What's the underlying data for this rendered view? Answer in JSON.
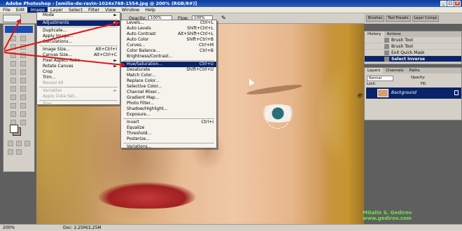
{
  "window": {
    "title": "Adobe Photoshop - [emilie-de-ravin-1024x768-1554.jpg @ 200% (RGB/8#)]"
  },
  "menubar": [
    "File",
    "Edit",
    "Image",
    "Layer",
    "Select",
    "Filter",
    "View",
    "Window",
    "Help"
  ],
  "options": {
    "opacity_label": "Opacity:",
    "opacity_value": "100%",
    "flow_label": "Flow:",
    "flow_value": "100%"
  },
  "wellbar": [
    "Brushes",
    "Tool Presets",
    "Layer Comps"
  ],
  "image_menu": [
    {
      "label": "Mode",
      "shortcut": "►"
    },
    {
      "sep": true
    },
    {
      "label": "Adjustments",
      "shortcut": "►",
      "state": "selected"
    },
    {
      "sep": true
    },
    {
      "label": "Duplicate..."
    },
    {
      "label": "Apply Image..."
    },
    {
      "label": "Calculations..."
    },
    {
      "sep": true
    },
    {
      "label": "Image Size...",
      "shortcut": "Alt+Ctrl+I"
    },
    {
      "label": "Canvas Size...",
      "shortcut": "Alt+Ctrl+C"
    },
    {
      "label": "Pixel Aspect Ratio",
      "shortcut": "►"
    },
    {
      "label": "Rotate Canvas",
      "shortcut": "►"
    },
    {
      "label": "Crop"
    },
    {
      "label": "Trim..."
    },
    {
      "label": "Reveal All",
      "state": "disabled"
    },
    {
      "sep": true
    },
    {
      "label": "Variables",
      "shortcut": "►",
      "state": "disabled"
    },
    {
      "label": "Apply Data Set...",
      "state": "disabled"
    },
    {
      "sep": true
    },
    {
      "label": "Trap...",
      "state": "disabled"
    }
  ],
  "adjustments_menu": [
    {
      "label": "Levels...",
      "shortcut": "Ctrl+L"
    },
    {
      "label": "Auto Levels",
      "shortcut": "Shift+Ctrl+L"
    },
    {
      "label": "Auto Contrast",
      "shortcut": "Alt+Shift+Ctrl+L"
    },
    {
      "label": "Auto Color",
      "shortcut": "Shift+Ctrl+B"
    },
    {
      "label": "Curves...",
      "shortcut": "Ctrl+M"
    },
    {
      "label": "Color Balance...",
      "shortcut": "Ctrl+B"
    },
    {
      "label": "Brightness/Contrast..."
    },
    {
      "sep": true
    },
    {
      "label": "Hue/Saturation...",
      "shortcut": "Ctrl+U",
      "state": "selected"
    },
    {
      "label": "Desaturate",
      "shortcut": "Shift+Ctrl+U"
    },
    {
      "label": "Match Color..."
    },
    {
      "label": "Replace Color..."
    },
    {
      "label": "Selective Color..."
    },
    {
      "label": "Channel Mixer..."
    },
    {
      "label": "Gradient Map..."
    },
    {
      "label": "Photo Filter..."
    },
    {
      "label": "Shadow/Highlight..."
    },
    {
      "label": "Exposure..."
    },
    {
      "sep": true
    },
    {
      "label": "Invert",
      "shortcut": "Ctrl+I"
    },
    {
      "label": "Equalize"
    },
    {
      "label": "Threshold..."
    },
    {
      "label": "Posterize..."
    },
    {
      "sep": true
    },
    {
      "label": "Variations..."
    }
  ],
  "history": {
    "tabs": [
      "History",
      "Actions"
    ],
    "items": [
      {
        "label": "Brush Tool"
      },
      {
        "label": "Brush Tool"
      },
      {
        "label": "Exit Quick Mask"
      },
      {
        "label": "Select Inverse",
        "state": "selected"
      }
    ]
  },
  "layers": {
    "tabs": [
      "Layers",
      "Channels",
      "Paths"
    ],
    "blend_mode": "Normal",
    "opacity_label": "Opacity:",
    "fill_label": "Fill:",
    "lock_label": "Lock:",
    "layer_name": "Background"
  },
  "watermark": [
    "MGalin S. Gedirov",
    "www.gedirov.com"
  ],
  "status": {
    "zoom": "200%",
    "doc": "Doc: 2,25M/2,25M"
  },
  "colors": {
    "menu_highlight": "#0a246a",
    "arrow": "#e01414",
    "watermark": "#6fe34a"
  }
}
